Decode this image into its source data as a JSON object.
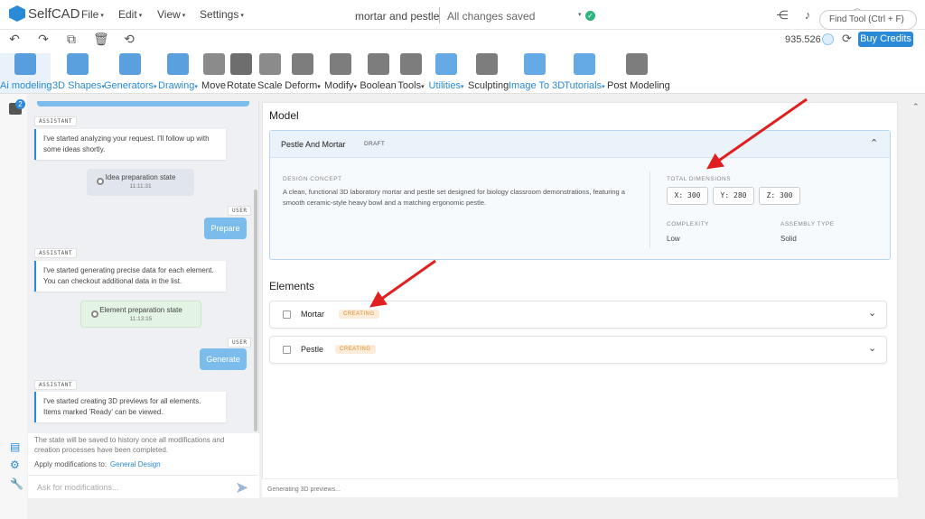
{
  "app": {
    "name": "SelfCAD"
  },
  "menu": {
    "file": "File",
    "edit": "Edit",
    "view": "View",
    "settings": "Settings"
  },
  "document": {
    "title": "mortar and pestle",
    "status": "All changes saved"
  },
  "header_icons": [
    "share-icon",
    "bell-icon",
    "user-icon",
    "info-icon",
    "percent-icon",
    "expand-icon"
  ],
  "quick_actions": [
    "undo-icon",
    "redo-icon",
    "copy-icon",
    "delete-icon",
    "reset-icon"
  ],
  "credits": {
    "value": "935.526",
    "buy_label": "Buy Credits"
  },
  "toolbar": [
    {
      "label": "Ai modeling",
      "caret": "",
      "active": true
    },
    {
      "label": "3D Shapes",
      "caret": "▾",
      "blue": true
    },
    {
      "label": "Generators",
      "caret": "▾",
      "blue": true
    },
    {
      "label": "Drawing",
      "caret": "▾",
      "blue": true
    },
    {
      "label": "Move",
      "caret": ""
    },
    {
      "label": "Rotate",
      "caret": ""
    },
    {
      "label": "Scale",
      "caret": ""
    },
    {
      "label": "Deform",
      "caret": "▾"
    },
    {
      "label": "Modify",
      "caret": "▾"
    },
    {
      "label": "Boolean",
      "caret": ""
    },
    {
      "label": "Tools",
      "caret": "▾"
    },
    {
      "label": "Utilities",
      "caret": "▾",
      "blue": true
    },
    {
      "label": "Sculpting",
      "caret": ""
    },
    {
      "label": "Image To 3D",
      "caret": "",
      "blue": true
    },
    {
      "label": "Tutorials",
      "caret": "▾",
      "blue": true
    },
    {
      "label": "Post Modeling",
      "caret": ""
    }
  ],
  "find_tool": {
    "placeholder": "Find Tool (Ctrl + F)"
  },
  "rail": {
    "badge": "2"
  },
  "chat": {
    "assistant_tag": "ASSISTANT",
    "user_tag": "USER",
    "msg1": "I've started analyzing your request. I'll follow up with some ideas shortly.",
    "state1": {
      "title": "Idea preparation state",
      "time": "11:11:31"
    },
    "user1": "Prepare",
    "msg2": "I've started generating precise data for each element. You can checkout additional data in the list.",
    "state2": {
      "title": "Element preparation state",
      "time": "11:13:15"
    },
    "user2": "Generate",
    "msg3": "I've started creating 3D previews for all elements. Items marked 'Ready' can be viewed.",
    "note": "The state will be saved to history once all modifications and creation processes have been completed.",
    "apply_label": "Apply modifications to:",
    "apply_target": "General Design",
    "ask_placeholder": "Ask for modifications..."
  },
  "model": {
    "heading": "Model",
    "name": "Pestle And Mortar",
    "badge": "DRAFT",
    "design_concept_label": "DESIGN CONCEPT",
    "design_concept": "A clean, functional 3D laboratory mortar and pestle set designed for biology classroom demonstrations, featuring a smooth ceramic-style heavy bowl and a matching ergonomic pestle.",
    "total_dimensions_label": "TOTAL DIMENSIONS",
    "dims": {
      "x": "X: 300",
      "y": "Y: 280",
      "z": "Z: 300"
    },
    "complexity_label": "COMPLEXITY",
    "complexity": "Low",
    "assembly_label": "ASSEMBLY TYPE",
    "assembly": "Solid"
  },
  "elements": {
    "heading": "Elements",
    "items": [
      {
        "name": "Mortar",
        "status": "CREATING"
      },
      {
        "name": "Pestle",
        "status": "CREATING"
      }
    ]
  },
  "footer": {
    "status": "Generating 3D previews..."
  },
  "colors": {
    "accent": "#2b8ad8",
    "annotation": "#e02020",
    "status_creating": "#e08a2e"
  }
}
